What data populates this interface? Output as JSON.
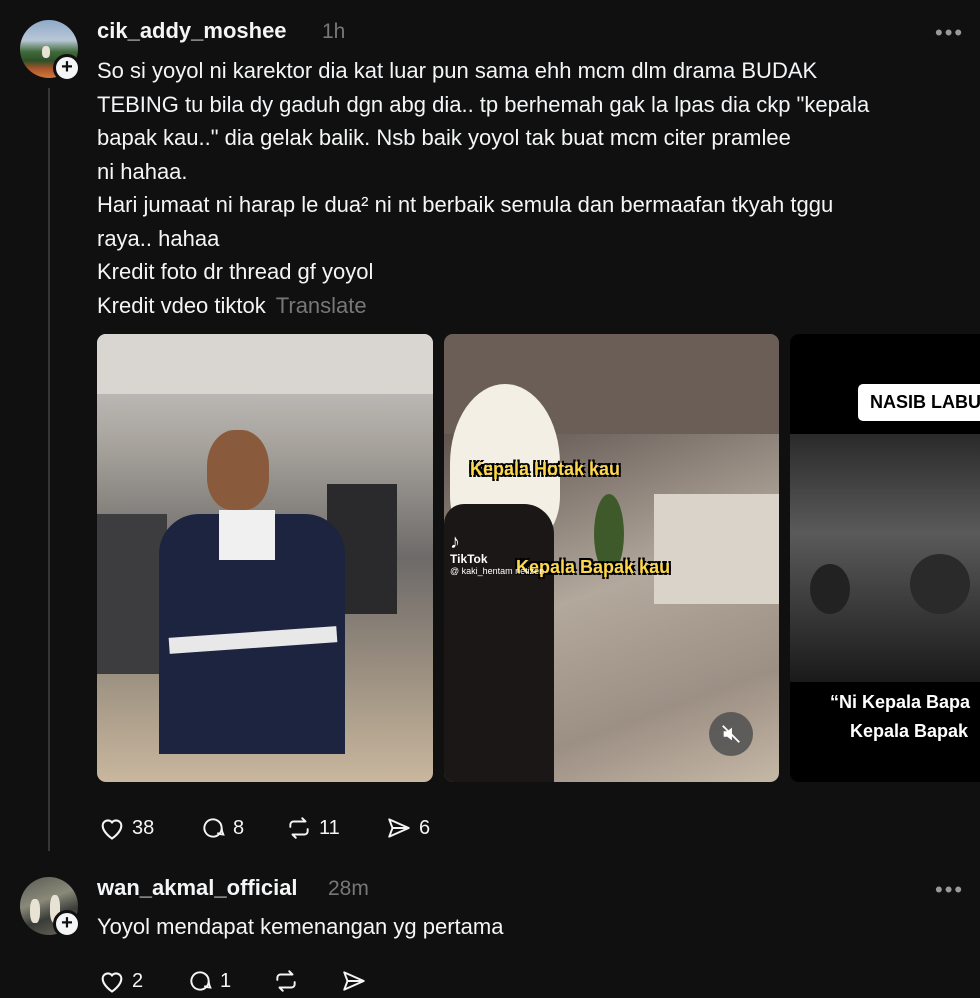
{
  "posts": [
    {
      "username": "cik_addy_moshee",
      "time": "1h",
      "more": "•••",
      "lines": [
        "So si yoyol ni karektor dia kat luar pun sama ehh mcm dlm drama BUDAK",
        "TEBING tu bila dy gaduh dgn abg dia.. tp berhemah gak la lpas dia ckp \"kepala",
        "bapak kau..\" dia gelak balik. Nsb baik yoyol tak buat mcm citer pramlee",
        "ni hahaa.",
        "Hari jumaat ni harap le dua² ni nt berbaik semula dan bermaafan tkyah tggu",
        "raya.. hahaa",
        "Kredit foto dr thread gf yoyol",
        "Kredit vdeo tiktok"
      ],
      "translate": "Translate",
      "media": {
        "video_caption_1": "Kepala Hotak kau",
        "video_caption_2": "Kepala Bapak kau",
        "tiktok_brand": "TikTok",
        "tiktok_handle": "@ kaki_hentam netizen",
        "image3_banner": "NASIB LABU",
        "image3_quote_1": "“Ni Kepala Bapa",
        "image3_quote_2": "Kepala Bapak"
      },
      "stats": {
        "likes": "38",
        "replies": "8",
        "reposts": "11",
        "shares": "6"
      }
    },
    {
      "username": "wan_akmal_official",
      "time": "28m",
      "more": "•••",
      "text": "Yoyol mendapat kemenangan yg pertama",
      "stats": {
        "likes": "2",
        "replies": "1",
        "reposts": "",
        "shares": ""
      }
    }
  ],
  "colors": {
    "background": "#101010",
    "text": "#f3f5f7",
    "muted": "#777777",
    "caption": "#ffd84a"
  }
}
